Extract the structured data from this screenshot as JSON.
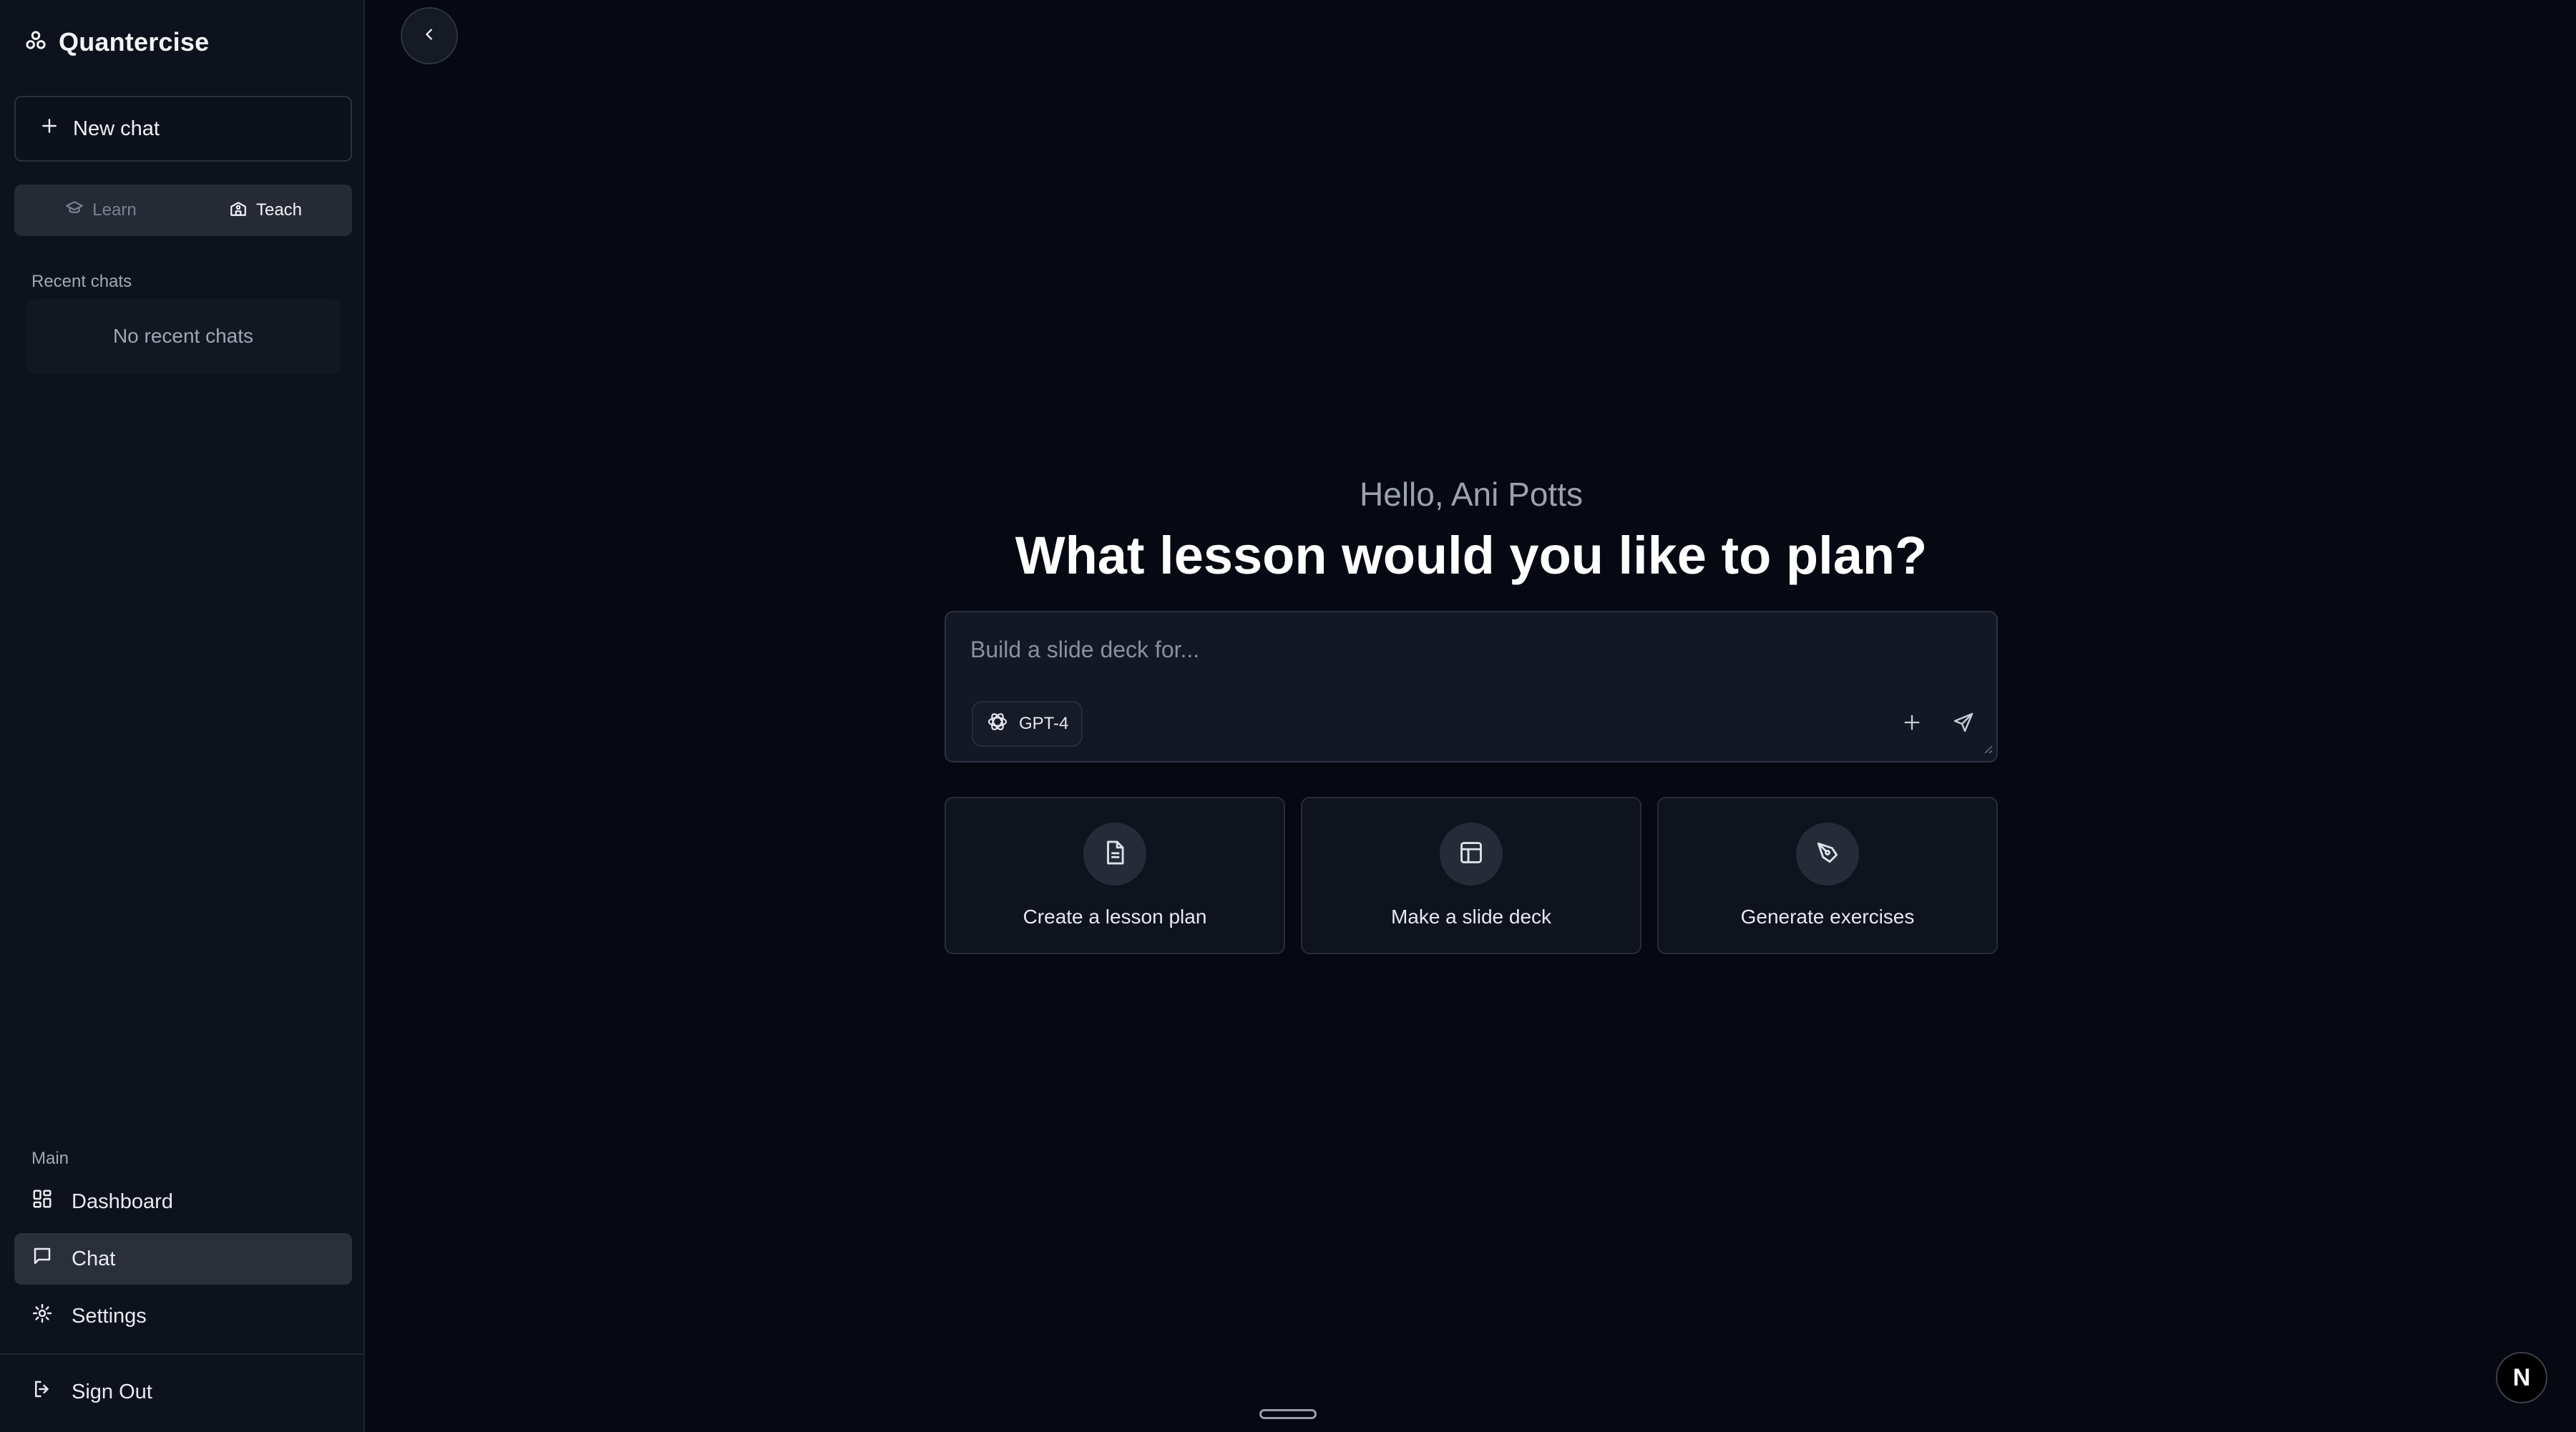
{
  "app": {
    "name": "Quantercise"
  },
  "sidebar": {
    "new_chat_label": "New chat",
    "modes": [
      {
        "label": "Learn",
        "icon": "graduation-cap-icon",
        "active": false
      },
      {
        "label": "Teach",
        "icon": "school-icon",
        "active": true
      }
    ],
    "recent_label": "Recent chats",
    "recent_empty": "No recent chats",
    "main_label": "Main",
    "nav": [
      {
        "label": "Dashboard",
        "icon": "dashboard-grid-icon",
        "active": false
      },
      {
        "label": "Chat",
        "icon": "chat-bubble-icon",
        "active": true
      },
      {
        "label": "Settings",
        "icon": "gear-icon",
        "active": false
      }
    ],
    "sign_out_label": "Sign Out"
  },
  "main": {
    "greeting": "Hello, Ani Potts",
    "headline": "What lesson would you like to plan?",
    "prompt": {
      "placeholder": "Build a slide deck for...",
      "value": ""
    },
    "model": "GPT-4",
    "cards": [
      {
        "label": "Create a lesson plan",
        "icon": "document-icon"
      },
      {
        "label": "Make a slide deck",
        "icon": "layout-icon"
      },
      {
        "label": "Generate exercises",
        "icon": "pen-tool-icon"
      }
    ]
  },
  "avatar_letter": "N",
  "colors": {
    "background": "#060812",
    "sidebar": "#0e121c",
    "active_item": "#2a2f3a",
    "text_primary": "#ffffff",
    "text_muted": "#9ba1ad"
  }
}
